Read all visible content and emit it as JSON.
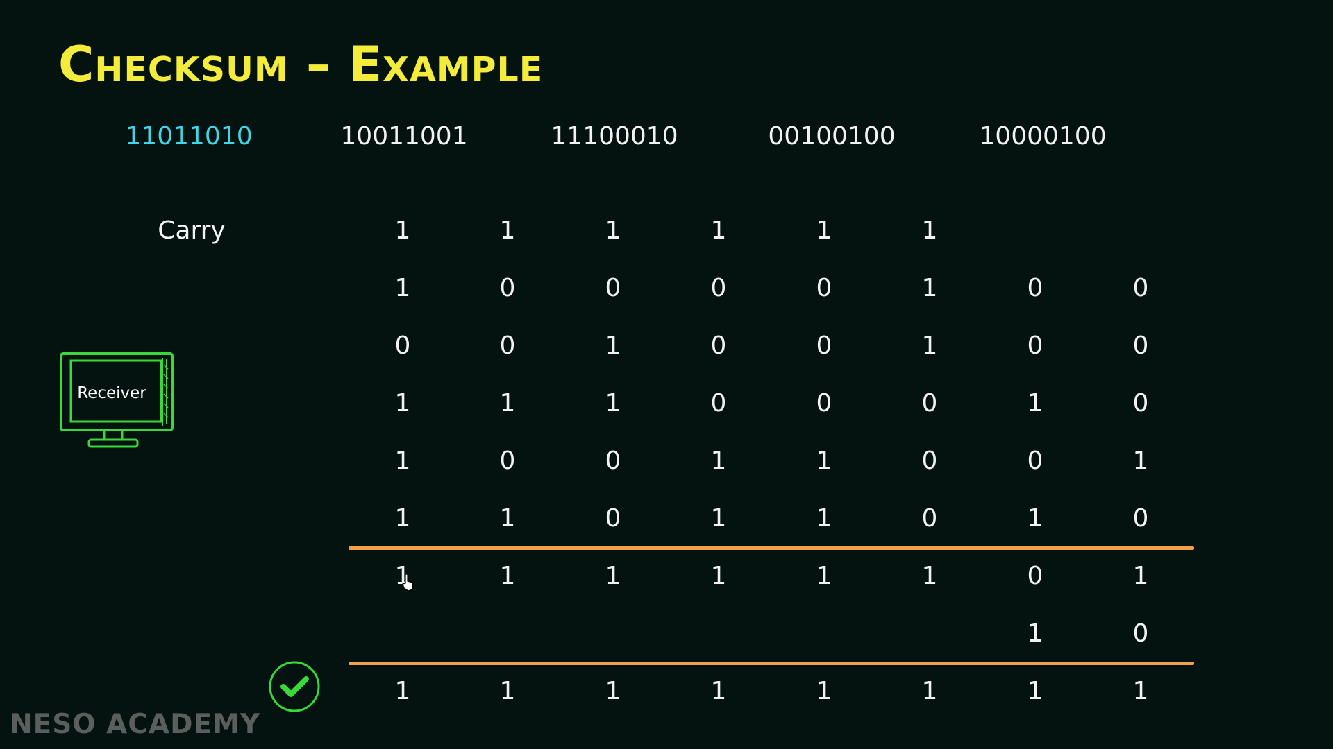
{
  "title": "Checksum – Example",
  "words": [
    "11011010",
    "10011001",
    "11100010",
    "00100100",
    "10000100"
  ],
  "carry_label": "Carry",
  "carry_row": [
    "1",
    "1",
    "1",
    "1",
    "1",
    "1",
    "",
    ""
  ],
  "addend_rows": [
    [
      "1",
      "0",
      "0",
      "0",
      "0",
      "1",
      "0",
      "0"
    ],
    [
      "0",
      "0",
      "1",
      "0",
      "0",
      "1",
      "0",
      "0"
    ],
    [
      "1",
      "1",
      "1",
      "0",
      "0",
      "0",
      "1",
      "0"
    ],
    [
      "1",
      "0",
      "0",
      "1",
      "1",
      "0",
      "0",
      "1"
    ],
    [
      "1",
      "1",
      "0",
      "1",
      "1",
      "0",
      "1",
      "0"
    ]
  ],
  "sum_row": [
    "1",
    "1",
    "1",
    "1",
    "1",
    "1",
    "0",
    "1"
  ],
  "wrap_row": [
    "",
    "",
    "",
    "",
    "",
    "",
    "1",
    "0"
  ],
  "result_row": [
    "1",
    "1",
    "1",
    "1",
    "1",
    "1",
    "1",
    "1"
  ],
  "receiver_label": "Receiver",
  "logo_text": "NESO ACADEMY",
  "colors": {
    "background": "#04130f",
    "title": "#f4ec3a",
    "highlight_word": "#3fd7e6",
    "rule": "#f0a14a",
    "receiver": "#39d93a",
    "check": "#39d93a"
  },
  "icons": [
    "receiver-monitor-icon",
    "checkmark-icon",
    "cursor-icon"
  ]
}
